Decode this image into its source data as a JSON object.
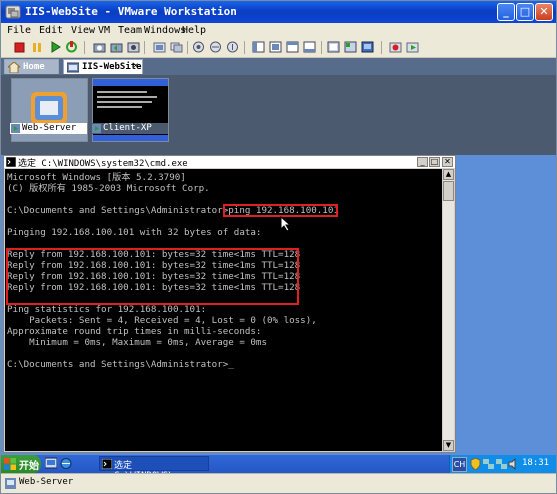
{
  "window": {
    "title": "IIS-WebSite - VMware Workstation"
  },
  "menu": [
    "File",
    "Edit",
    "View",
    "VM",
    "Team",
    "Windows",
    "Help"
  ],
  "tabs": [
    {
      "label": "Home"
    },
    {
      "label": "IIS-WebSite"
    }
  ],
  "thumbnails": [
    {
      "label": "Web-Server"
    },
    {
      "label": "Client-XP"
    }
  ],
  "cmd": {
    "title": "选定 C:\\WINDOWS\\system32\\cmd.exe",
    "lines": [
      "Microsoft Windows [版本 5.2.3790]",
      "(C) 版权所有 1985-2003 Microsoft Corp.",
      "",
      "C:\\Documents and Settings\\Administrator>ping 192.168.100.101",
      "",
      "Pinging 192.168.100.101 with 32 bytes of data:",
      "",
      "Reply from 192.168.100.101: bytes=32 time<1ms TTL=128",
      "Reply from 192.168.100.101: bytes=32 time<1ms TTL=128",
      "Reply from 192.168.100.101: bytes=32 time<1ms TTL=128",
      "Reply from 192.168.100.101: bytes=32 time<1ms TTL=128",
      "",
      "Ping statistics for 192.168.100.101:",
      "    Packets: Sent = 4, Received = 4, Lost = 0 (0% loss),",
      "Approximate round trip times in milli-seconds:",
      "    Minimum = 0ms, Maximum = 0ms, Average = 0ms",
      "",
      "C:\\Documents and Settings\\Administrator>_"
    ]
  },
  "taskbar": {
    "start_label": "开始",
    "task_label": "选定 C:\\WINDOWS\\sys...",
    "clock": "18:31",
    "lang": "CH"
  },
  "status": {
    "text": "Web-Server"
  }
}
